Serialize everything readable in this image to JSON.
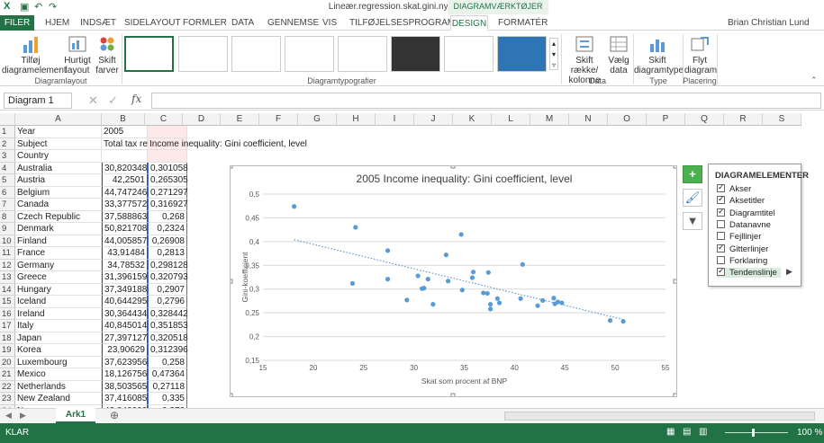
{
  "window": {
    "title": "Lineær.regression.skat.gini.ny.xlsx - Excel",
    "user": "Brian Christian Lund"
  },
  "ribbon": {
    "context_header": "DIAGRAMVÆRKTØJER",
    "tabs": [
      "FILER",
      "HJEM",
      "INDSÆT",
      "SIDELAYOUT",
      "FORMLER",
      "DATA",
      "GENNEMSE",
      "VIS",
      "TILFØJELSESPROGRAMMER",
      "DESIGN",
      "FORMATÉR"
    ],
    "buttons": {
      "add_element": "Tilføj diagramelement",
      "quick_layout": "Hurtigt layout",
      "change_colors": "Skift farver",
      "switch_row_col": "Skift række/ kolonne",
      "select_data": "Vælg data",
      "change_type": "Skift diagramtype",
      "move_chart": "Flyt diagram"
    },
    "groups": {
      "layouts": "Diagramlayout",
      "styles": "Diagramtypografier",
      "data": "Data",
      "type": "Type",
      "location": "Placering"
    }
  },
  "formula_bar": {
    "name_box": "Diagram 1",
    "fx": "fx",
    "value": ""
  },
  "columns": [
    "A",
    "B",
    "C",
    "D",
    "E",
    "F",
    "G",
    "H",
    "I",
    "J",
    "K",
    "L",
    "M",
    "N",
    "O",
    "P",
    "Q",
    "R",
    "S"
  ],
  "rows": [
    {
      "n": "1",
      "a": "Year",
      "b": "2005",
      "c": ""
    },
    {
      "n": "2",
      "a": "Subject",
      "b": "Total tax rev",
      "c": "Income inequality: Gini coefficient, level"
    },
    {
      "n": "3",
      "a": "Country",
      "b": "",
      "c": ""
    },
    {
      "n": "4",
      "a": "Australia",
      "b": "30,820348",
      "c": "0,301058"
    },
    {
      "n": "5",
      "a": "Austria",
      "b": "42,2501",
      "c": "0,265305"
    },
    {
      "n": "6",
      "a": "Belgium",
      "b": "44,747246",
      "c": "0,271297"
    },
    {
      "n": "7",
      "a": "Canada",
      "b": "33,377572",
      "c": "0,316927"
    },
    {
      "n": "8",
      "a": "Czech Republic",
      "b": "37,588863",
      "c": "0,268"
    },
    {
      "n": "9",
      "a": "Denmark",
      "b": "50,821708",
      "c": "0,2324"
    },
    {
      "n": "10",
      "a": "Finland",
      "b": "44,005857",
      "c": "0,26908"
    },
    {
      "n": "11",
      "a": "France",
      "b": "43,91484",
      "c": "0,2813"
    },
    {
      "n": "12",
      "a": "Germany",
      "b": "34,78532",
      "c": "0,298128"
    },
    {
      "n": "13",
      "a": "Greece",
      "b": "31,396159",
      "c": "0,320793"
    },
    {
      "n": "14",
      "a": "Hungary",
      "b": "37,349188",
      "c": "0,2907"
    },
    {
      "n": "15",
      "a": "Iceland",
      "b": "40,644295",
      "c": "0,2796"
    },
    {
      "n": "16",
      "a": "Ireland",
      "b": "30,364434",
      "c": "0,328442"
    },
    {
      "n": "17",
      "a": "Italy",
      "b": "40,845014",
      "c": "0,351853"
    },
    {
      "n": "18",
      "a": "Japan",
      "b": "27,397127",
      "c": "0,320518"
    },
    {
      "n": "19",
      "a": "Korea",
      "b": "23,90629",
      "c": "0,312396"
    },
    {
      "n": "20",
      "a": "Luxembourg",
      "b": "37,623956",
      "c": "0,258"
    },
    {
      "n": "21",
      "a": "Mexico",
      "b": "18,126756",
      "c": "0,47364"
    },
    {
      "n": "22",
      "a": "Netherlands",
      "b": "38,503565",
      "c": "0,27118"
    },
    {
      "n": "23",
      "a": "New Zealand",
      "b": "37,416085",
      "c": "0,335"
    },
    {
      "n": "24",
      "a": "Norway",
      "b": "42,840000",
      "c": "0,276"
    }
  ],
  "chart_data": {
    "type": "scatter",
    "title": "2005 Income inequality: Gini coefficient, level",
    "xlabel": "Skat som procent af BNP",
    "ylabel": "Gini-koefficient",
    "xlim": [
      15,
      55
    ],
    "ylim": [
      0.15,
      0.5
    ],
    "xticks": [
      "15",
      "20",
      "25",
      "30",
      "35",
      "40",
      "45",
      "50",
      "55"
    ],
    "yticks": [
      "0,15",
      "0,2",
      "0,25",
      "0,3",
      "0,35",
      "0,4",
      "0,45",
      "0,5"
    ],
    "trendline": {
      "x": [
        18.1,
        50.8
      ],
      "y": [
        0.404,
        0.236
      ],
      "style": "dotted"
    },
    "points": [
      [
        30.8,
        0.301
      ],
      [
        42.3,
        0.265
      ],
      [
        44.7,
        0.271
      ],
      [
        33.4,
        0.317
      ],
      [
        37.6,
        0.268
      ],
      [
        50.8,
        0.232
      ],
      [
        44.0,
        0.269
      ],
      [
        43.9,
        0.281
      ],
      [
        34.8,
        0.298
      ],
      [
        31.4,
        0.321
      ],
      [
        37.3,
        0.291
      ],
      [
        40.6,
        0.28
      ],
      [
        30.4,
        0.328
      ],
      [
        40.8,
        0.352
      ],
      [
        27.4,
        0.321
      ],
      [
        23.9,
        0.312
      ],
      [
        37.6,
        0.258
      ],
      [
        18.1,
        0.474
      ],
      [
        38.5,
        0.271
      ],
      [
        37.4,
        0.335
      ],
      [
        42.8,
        0.276
      ],
      [
        24.2,
        0.43
      ],
      [
        27.4,
        0.381
      ],
      [
        34.7,
        0.415
      ],
      [
        33.2,
        0.372
      ],
      [
        35.9,
        0.336
      ],
      [
        35.8,
        0.324
      ],
      [
        29.3,
        0.277
      ],
      [
        31.9,
        0.268
      ],
      [
        31.0,
        0.302
      ],
      [
        49.5,
        0.234
      ],
      [
        44.3,
        0.273
      ],
      [
        36.9,
        0.292
      ],
      [
        38.3,
        0.28
      ]
    ],
    "color": "#5b9bd5"
  },
  "flyout": {
    "title": "DIAGRAMELEMENTER",
    "items": [
      {
        "label": "Akser",
        "checked": true
      },
      {
        "label": "Aksetitler",
        "checked": true
      },
      {
        "label": "Diagramtitel",
        "checked": true
      },
      {
        "label": "Datanavne",
        "checked": false
      },
      {
        "label": "Fejllinjer",
        "checked": false
      },
      {
        "label": "Gitterlinjer",
        "checked": true
      },
      {
        "label": "Forklaring",
        "checked": false
      },
      {
        "label": "Tendenslinje",
        "checked": true
      }
    ]
  },
  "sheet_tab": "Ark1",
  "status": {
    "left": "KLAR",
    "zoom": "100 %"
  },
  "colors": {
    "accent": "#217346"
  }
}
